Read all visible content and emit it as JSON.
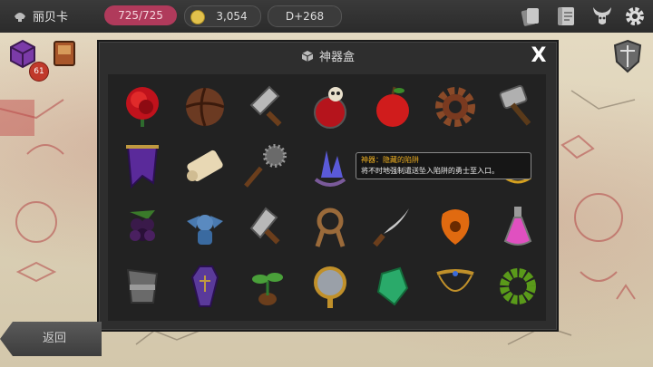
{
  "topbar": {
    "player_name": "丽贝卡",
    "hp": "725/725",
    "gold": "3,054",
    "depth": "D+268",
    "buttons": [
      "cards-icon",
      "scroll-map-icon",
      "horned-helmet-icon",
      "gear-icon"
    ]
  },
  "left_panel": {
    "item_count_badge": "61"
  },
  "modal": {
    "title": "神器盒",
    "close_label": "X",
    "items": [
      [
        "red-rose",
        "leather-ball",
        "trowel",
        "blood-potion-skull",
        "red-apple",
        "rusty-gear",
        "war-hammer"
      ],
      [
        "purple-banner",
        "paper-scroll",
        "spiked-flail",
        "crystal-cluster",
        "pink-orb",
        "pink-horn",
        "red-amulet"
      ],
      [
        "black-grapes",
        "blue-gargoyle",
        "trowel-2",
        "rope-coil",
        "curved-dagger",
        "amber-gem",
        "pink-potion"
      ],
      [
        "iron-bracer",
        "purple-coffin",
        "green-sprout",
        "hand-mirror",
        "green-crystal",
        "jeweled-necklace",
        "green-bead-bracelet"
      ]
    ]
  },
  "tooltip": {
    "title": "神器：隐藏的陷阱",
    "description": "将不时地强制遣送坠入陷阱的勇士至入口。"
  },
  "back_button": {
    "label": "返回"
  }
}
